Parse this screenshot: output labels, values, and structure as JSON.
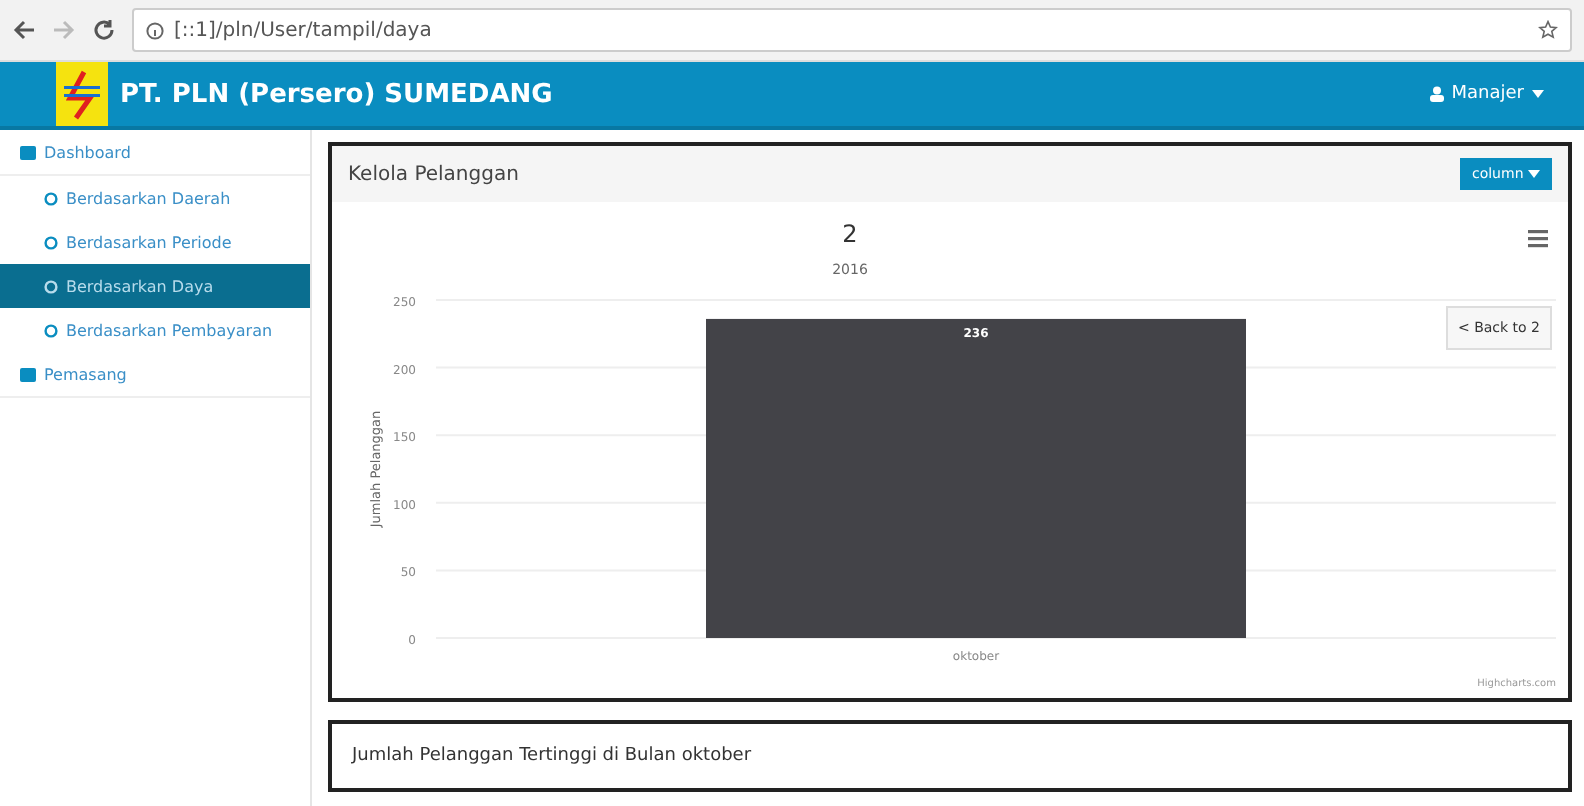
{
  "browser": {
    "url": "[::1]/pln/User/tampil/daya"
  },
  "header": {
    "title": "PT. PLN (Persero) SUMEDANG",
    "user": "Manajer"
  },
  "sidebar": {
    "items": [
      {
        "label": "Dashboard",
        "kind": "section",
        "selected": false,
        "children": [
          {
            "label": "Berdasarkan Daerah",
            "kind": "sub",
            "selected": false
          },
          {
            "label": "Berdasarkan Periode",
            "kind": "sub",
            "selected": false
          },
          {
            "label": "Berdasarkan Daya",
            "kind": "sub",
            "selected": true
          },
          {
            "label": "Berdasarkan Pembayaran",
            "kind": "sub",
            "selected": false
          }
        ]
      },
      {
        "label": "Pemasang",
        "kind": "section",
        "selected": false
      }
    ]
  },
  "panel": {
    "title": "Kelola Pelanggan",
    "button": "column",
    "back_button": "< Back to 2",
    "credit": "Highcharts.com",
    "chart_data": {
      "type": "bar",
      "title": "2",
      "subtitle": "2016",
      "ylabel": "Jumlah Pelanggan",
      "categories": [
        "oktober"
      ],
      "series": [
        {
          "color": "#434348",
          "values": [
            236
          ]
        }
      ],
      "grid": true,
      "ylim": [
        0,
        250
      ],
      "yticks": [
        0,
        50,
        100,
        150,
        200,
        250
      ],
      "data_labels": true,
      "value_labels": [
        "236"
      ]
    }
  },
  "footer_panel": {
    "text": "Jumlah Pelanggan Tertinggi di Bulan oktober"
  }
}
